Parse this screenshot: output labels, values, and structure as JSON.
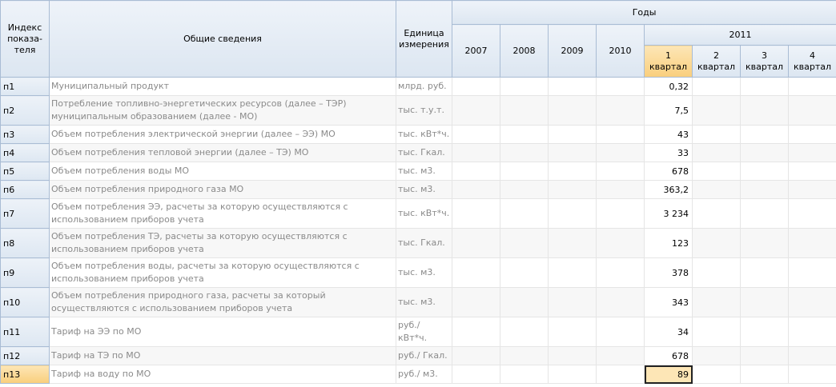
{
  "header": {
    "index_label": [
      "Индекс",
      "показа-",
      "теля"
    ],
    "info_label": "Общие сведения",
    "unit_label": [
      "Единица",
      "измерения"
    ],
    "years_label": "Годы",
    "years": [
      "2007",
      "2008",
      "2009",
      "2010"
    ],
    "year_2011": "2011",
    "quarters": [
      [
        "1",
        "квартал"
      ],
      [
        "2",
        "квартал"
      ],
      [
        "3",
        "квартал"
      ],
      [
        "4",
        "квартал"
      ]
    ]
  },
  "rows": [
    {
      "index": "п1",
      "desc": "Муниципальный продукт",
      "unit": "млрд. руб.",
      "value": "0,32"
    },
    {
      "index": "п2",
      "desc": "Потребление топливно-энергетических ресурсов (далее – ТЭР) муниципальным образованием (далее -  МО)",
      "unit": "тыс. т.у.т.",
      "value": "7,5"
    },
    {
      "index": "п3",
      "desc": "Объем потребления электрической энергии (далее – ЭЭ) МО",
      "unit": "тыс. кВт*ч.",
      "value": "43"
    },
    {
      "index": "п4",
      "desc": "Объем потребления тепловой энергии (далее – ТЭ) МО",
      "unit": "тыс. Гкал.",
      "value": "33"
    },
    {
      "index": "п5",
      "desc": "Объем потребления воды МО",
      "unit": "тыс. м3.",
      "value": "678"
    },
    {
      "index": "п6",
      "desc": "Объем потребления природного газа МО",
      "unit": "тыс. м3.",
      "value": "363,2"
    },
    {
      "index": "п7",
      "desc": "Объем потребления ЭЭ, расчеты за которую осуществляются с использованием приборов учета",
      "unit": "тыс. кВт*ч.",
      "value": "3 234"
    },
    {
      "index": "п8",
      "desc": "Объем потребления ТЭ, расчеты за которую осуществляются с использованием приборов учета",
      "unit": "тыс. Гкал.",
      "value": "123"
    },
    {
      "index": "п9",
      "desc": "Объем потребления воды, расчеты за которую осуществляются с использованием приборов учета",
      "unit": "тыс. м3.",
      "value": "378"
    },
    {
      "index": "п10",
      "desc": "Объем потребления природного газа, расчеты за который осуществляются с использованием приборов учета",
      "unit": "тыс. м3.",
      "value": "343"
    },
    {
      "index": "п11",
      "desc": "Тариф на ЭЭ по МО",
      "unit": "руб./ кВт*ч.",
      "value": "34"
    },
    {
      "index": "п12",
      "desc": "Тариф на ТЭ по МО",
      "unit": "руб./ Гкал.",
      "value": "678"
    },
    {
      "index": "п13",
      "desc": "Тариф на воду по МО",
      "unit": "руб./ м3.",
      "value": "89"
    }
  ]
}
